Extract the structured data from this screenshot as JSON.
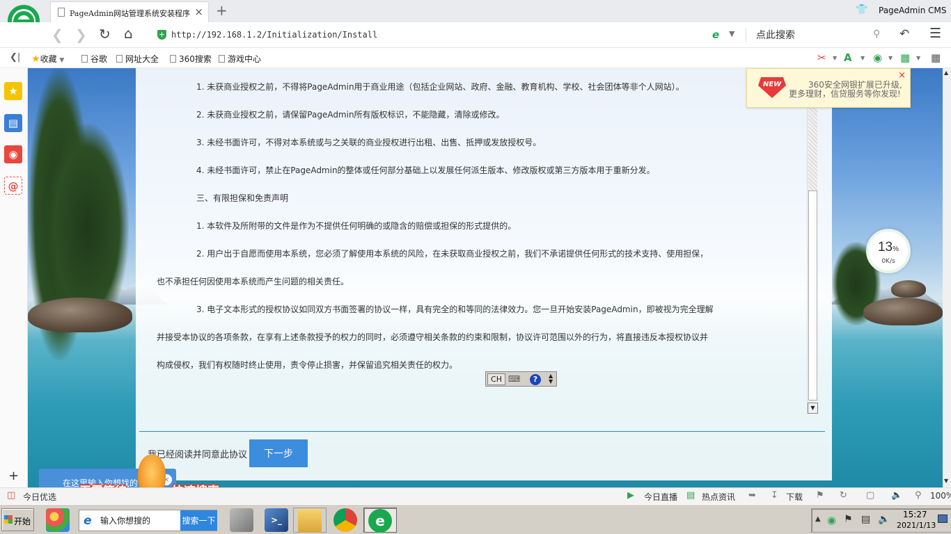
{
  "browser": {
    "tab_title": "PageAdmin网站管理系统安装程序",
    "tab_close": "×",
    "new_tab": "+",
    "user_label": "PageAdmin CMS",
    "url": "http://192.168.1.2/Initialization/Install",
    "search_placeholder": "点此搜索"
  },
  "bookmarks": {
    "favorites": "收藏",
    "items": [
      "谷歌",
      "网址大全",
      "360搜索",
      "游戏中心"
    ]
  },
  "page": {
    "paragraphs": [
      "1. 未获商业授权之前，不得将PageAdmin用于商业用途（包括企业网站、政府、金融、教育机构、学校、社会团体等非个人网站）。",
      "2. 未获商业授权之前，请保留PageAdmin所有版权标识，不能隐藏，清除或修改。",
      "3. 未经书面许可，不得对本系统或与之关联的商业授权进行出租、出售、抵押或发放授权号。",
      "4. 未经书面许可，禁止在PageAdmin的整体或任何部分基础上以发展任何派生版本、修改版权或第三方版本用于重新分发。",
      "三、有限担保和免责声明",
      "1. 本软件及所附带的文件是作为不提供任何明确的或隐含的赔偿或担保的形式提供的。",
      "2. 用户出于自愿而使用本系统，您必须了解使用本系统的风险，在未获取商业授权之前，我们不承诺提供任何形式的技术支持、使用担保，",
      "也不承担任何因使用本系统而产生问题的相关责任。",
      "3. 电子文本形式的授权协议如同双方书面签署的协议一样，具有完全的和等同的法律效力。您一旦开始安装PageAdmin，即被视为完全理解",
      "并接受本协议的各项条款，在享有上述条款授予的权力的同时，必须遵守相关条款的约束和限制，协议许可范围以外的行为，将直接违反本授权协议并",
      "构成侵权，我们有权随时终止使用，责令停止损害，并保留追究相关责任的权力。"
    ],
    "agree_label": "我已经阅读并同意此协议",
    "next_button": "下一步"
  },
  "ime": {
    "mode": "CH",
    "help": "?"
  },
  "notice": {
    "new_tag": "NEW",
    "line1": "360安全网银扩展已升级,",
    "line2": "更多理财，信贷服务等你发现!",
    "close": "×"
  },
  "speed": {
    "percent": "13",
    "percent_unit": "%",
    "rate": "0K/s"
  },
  "promo": {
    "hint": "在这里输入你想找的",
    "text_left": "无需等待",
    "text_right": "快速搜索"
  },
  "statusbar": {
    "today": "今日优选",
    "live": "今日直播",
    "news": "热点资讯",
    "download": "下载",
    "zoom": "100%"
  },
  "taskbar": {
    "start": "开始",
    "search_placeholder": "输入你想搜的",
    "search_button": "搜索一下",
    "time": "15:27",
    "date": "2021/1/13"
  },
  "colors": {
    "accent_button": "#3c8dde",
    "divider": "#2a8fa6",
    "logo_green": "#1aa84f"
  }
}
